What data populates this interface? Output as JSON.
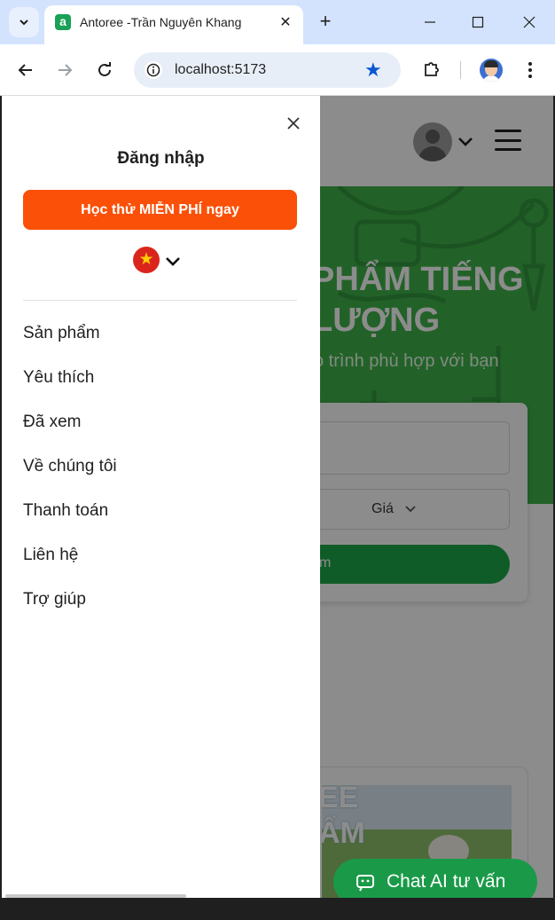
{
  "browser": {
    "tab_title": "Antoree -Trần Nguyên Khang",
    "favicon_letter": "a",
    "url": "localhost:5173"
  },
  "page": {
    "hero_title_line1": "PHẨM TIẾNG",
    "hero_title_line2": "LƯỢNG",
    "hero_subtitle": "o trình phù hợp với bạn",
    "price_filter_label": "Giá",
    "search_button_label": "m",
    "product_thumb_text_line1": "EE",
    "product_thumb_text_line2": "ẨM",
    "chat_button_label": "Chat AI tư vấn",
    "accent_color": "#1ea84b"
  },
  "drawer": {
    "login_label": "Đăng nhập",
    "trial_button_label": "Học thử MIỄN PHÍ ngay",
    "trial_button_color": "#fa5007",
    "language_flag": "★",
    "menu_items": [
      {
        "label": "Sản phẩm"
      },
      {
        "label": "Yêu thích"
      },
      {
        "label": "Đã xem"
      },
      {
        "label": "Về chúng tôi"
      },
      {
        "label": "Thanh toán"
      },
      {
        "label": "Liên hệ"
      },
      {
        "label": "Trợ giúp"
      }
    ]
  }
}
